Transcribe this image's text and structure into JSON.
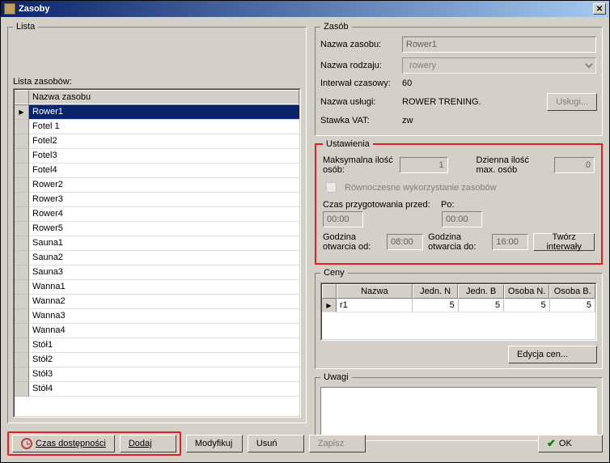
{
  "window": {
    "title": "Zasoby"
  },
  "left": {
    "fieldset_title": "Lista",
    "list_label": "Lista zasobów:",
    "header": "Nazwa zasobu",
    "items": [
      "Rower1",
      "Fotel 1",
      "Fotel2",
      "Fotel3",
      "Fotel4",
      "Rower2",
      "Rower3",
      "Rower4",
      "Rower5",
      "Sauna1",
      "Sauna2",
      "Sauna3",
      "Wanna1",
      "Wanna2",
      "Wanna3",
      "Wanna4",
      "Stół1",
      "Stół2",
      "Stół3",
      "Stół4"
    ],
    "selected_index": 0
  },
  "zasob": {
    "title": "Zasób",
    "nazwa_zasobu_label": "Nazwa zasobu:",
    "nazwa_zasobu": "Rower1",
    "nazwa_rodzaju_label": "Nazwa rodzaju:",
    "nazwa_rodzaju": "rowery",
    "interwal_label": "Interwał czasowy:",
    "interwal": "60",
    "nazwa_uslugi_label": "Nazwa usługi:",
    "nazwa_uslugi": "ROWER TRENING.",
    "stawka_vat_label": "Stawka VAT:",
    "stawka_vat": "zw",
    "uslugi_btn": "Usługi..."
  },
  "ustawienia": {
    "title": "Ustawienia",
    "max_osob_label": "Maksymalna ilość osób:",
    "max_osob": "1",
    "dzienna_label": "Dzienna ilość max. osób",
    "dzienna": "0",
    "rownoczesne_label": "Równoczesne wykorzystanie zasobów",
    "czas_przed_label": "Czas przygotowania przed:",
    "po_label": "Po:",
    "czas_przed": "00:00",
    "czas_po": "00:00",
    "otw_od_label": "Godzina otwarcia od:",
    "otw_od": "08:00",
    "otw_do_label": "Godzina otwarcia do:",
    "otw_do": "16:00",
    "tworz_btn": "Twórz interwały"
  },
  "ceny": {
    "title": "Ceny",
    "headers": {
      "nazwa": "Nazwa",
      "jedn_n": "Jedn. N",
      "jedn_b": "Jedn. B",
      "osoba_n": "Osoba N.",
      "osoba_b": "Osoba B."
    },
    "rows": [
      {
        "nazwa": "r1",
        "jedn_n": "5",
        "jedn_b": "5",
        "osoba_n": "5",
        "osoba_b": "5"
      }
    ],
    "edycja_btn": "Edycja cen..."
  },
  "uwagi": {
    "title": "Uwagi"
  },
  "buttons": {
    "czas_dost": "Czas dostępności",
    "dodaj": "Dodaj",
    "modyfikuj": "Modyfikuj",
    "usun": "Usuń",
    "zapisz": "Zapisz",
    "ok": "OK"
  }
}
